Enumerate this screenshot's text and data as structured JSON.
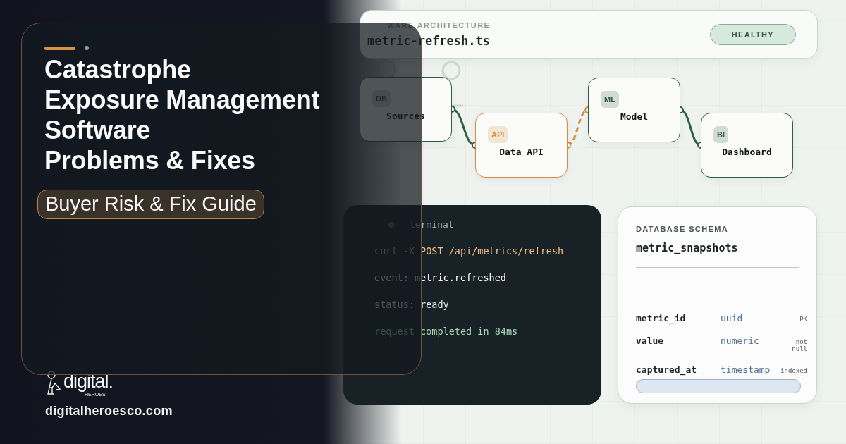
{
  "title_card": {
    "title_lines": [
      "Catastrophe",
      "Exposure Management",
      "Software",
      "Problems & Fixes"
    ],
    "tag": "Buyer Risk & Fix Guide"
  },
  "brand": {
    "logo_word": "digital.",
    "logo_sub": "HEROES.",
    "url": "digitalheroesco.com"
  },
  "architecture": {
    "label": "WARE ARCHITECTURE",
    "file": "metric-refresh.ts",
    "status": "HEALTHY",
    "nodes": [
      {
        "badge": "DB",
        "name": "Sources",
        "color": "#2f5d48"
      },
      {
        "badge": "API",
        "name": "Data API",
        "color": "#d98b3e"
      },
      {
        "badge": "ML",
        "name": "Model",
        "color": "#2f5d48"
      },
      {
        "badge": "BI",
        "name": "Dashboard",
        "color": "#2f5d48"
      }
    ],
    "links": [
      {
        "dashed": false
      },
      {
        "dashed": true
      },
      {
        "dashed": false
      }
    ]
  },
  "terminal": {
    "title": "terminal",
    "lines": [
      {
        "kind": "command",
        "text": "curl -X POST /api/metrics/refresh"
      },
      {
        "kind": "event",
        "text": "event: metric.refreshed"
      },
      {
        "kind": "status",
        "text": "status: ready"
      },
      {
        "kind": "success",
        "text": "request completed in 84ms"
      }
    ]
  },
  "schema": {
    "label": "DATABASE SCHEMA",
    "table": "metric_snapshots",
    "columns": [
      {
        "name": "metric_id",
        "type": "uuid",
        "note": "PK"
      },
      {
        "name": "value",
        "type": "numeric",
        "note": "not null"
      },
      {
        "name": "captured_at",
        "type": "timestamp",
        "note": "indexed"
      }
    ]
  }
}
